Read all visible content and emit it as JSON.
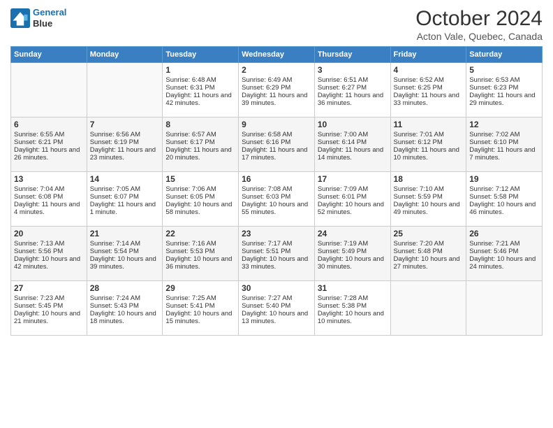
{
  "header": {
    "logo_line1": "General",
    "logo_line2": "Blue",
    "month": "October 2024",
    "location": "Acton Vale, Quebec, Canada"
  },
  "weekdays": [
    "Sunday",
    "Monday",
    "Tuesday",
    "Wednesday",
    "Thursday",
    "Friday",
    "Saturday"
  ],
  "weeks": [
    [
      {
        "day": "",
        "sunrise": "",
        "sunset": "",
        "daylight": ""
      },
      {
        "day": "",
        "sunrise": "",
        "sunset": "",
        "daylight": ""
      },
      {
        "day": "1",
        "sunrise": "Sunrise: 6:48 AM",
        "sunset": "Sunset: 6:31 PM",
        "daylight": "Daylight: 11 hours and 42 minutes."
      },
      {
        "day": "2",
        "sunrise": "Sunrise: 6:49 AM",
        "sunset": "Sunset: 6:29 PM",
        "daylight": "Daylight: 11 hours and 39 minutes."
      },
      {
        "day": "3",
        "sunrise": "Sunrise: 6:51 AM",
        "sunset": "Sunset: 6:27 PM",
        "daylight": "Daylight: 11 hours and 36 minutes."
      },
      {
        "day": "4",
        "sunrise": "Sunrise: 6:52 AM",
        "sunset": "Sunset: 6:25 PM",
        "daylight": "Daylight: 11 hours and 33 minutes."
      },
      {
        "day": "5",
        "sunrise": "Sunrise: 6:53 AM",
        "sunset": "Sunset: 6:23 PM",
        "daylight": "Daylight: 11 hours and 29 minutes."
      }
    ],
    [
      {
        "day": "6",
        "sunrise": "Sunrise: 6:55 AM",
        "sunset": "Sunset: 6:21 PM",
        "daylight": "Daylight: 11 hours and 26 minutes."
      },
      {
        "day": "7",
        "sunrise": "Sunrise: 6:56 AM",
        "sunset": "Sunset: 6:19 PM",
        "daylight": "Daylight: 11 hours and 23 minutes."
      },
      {
        "day": "8",
        "sunrise": "Sunrise: 6:57 AM",
        "sunset": "Sunset: 6:17 PM",
        "daylight": "Daylight: 11 hours and 20 minutes."
      },
      {
        "day": "9",
        "sunrise": "Sunrise: 6:58 AM",
        "sunset": "Sunset: 6:16 PM",
        "daylight": "Daylight: 11 hours and 17 minutes."
      },
      {
        "day": "10",
        "sunrise": "Sunrise: 7:00 AM",
        "sunset": "Sunset: 6:14 PM",
        "daylight": "Daylight: 11 hours and 14 minutes."
      },
      {
        "day": "11",
        "sunrise": "Sunrise: 7:01 AM",
        "sunset": "Sunset: 6:12 PM",
        "daylight": "Daylight: 11 hours and 10 minutes."
      },
      {
        "day": "12",
        "sunrise": "Sunrise: 7:02 AM",
        "sunset": "Sunset: 6:10 PM",
        "daylight": "Daylight: 11 hours and 7 minutes."
      }
    ],
    [
      {
        "day": "13",
        "sunrise": "Sunrise: 7:04 AM",
        "sunset": "Sunset: 6:08 PM",
        "daylight": "Daylight: 11 hours and 4 minutes."
      },
      {
        "day": "14",
        "sunrise": "Sunrise: 7:05 AM",
        "sunset": "Sunset: 6:07 PM",
        "daylight": "Daylight: 11 hours and 1 minute."
      },
      {
        "day": "15",
        "sunrise": "Sunrise: 7:06 AM",
        "sunset": "Sunset: 6:05 PM",
        "daylight": "Daylight: 10 hours and 58 minutes."
      },
      {
        "day": "16",
        "sunrise": "Sunrise: 7:08 AM",
        "sunset": "Sunset: 6:03 PM",
        "daylight": "Daylight: 10 hours and 55 minutes."
      },
      {
        "day": "17",
        "sunrise": "Sunrise: 7:09 AM",
        "sunset": "Sunset: 6:01 PM",
        "daylight": "Daylight: 10 hours and 52 minutes."
      },
      {
        "day": "18",
        "sunrise": "Sunrise: 7:10 AM",
        "sunset": "Sunset: 5:59 PM",
        "daylight": "Daylight: 10 hours and 49 minutes."
      },
      {
        "day": "19",
        "sunrise": "Sunrise: 7:12 AM",
        "sunset": "Sunset: 5:58 PM",
        "daylight": "Daylight: 10 hours and 46 minutes."
      }
    ],
    [
      {
        "day": "20",
        "sunrise": "Sunrise: 7:13 AM",
        "sunset": "Sunset: 5:56 PM",
        "daylight": "Daylight: 10 hours and 42 minutes."
      },
      {
        "day": "21",
        "sunrise": "Sunrise: 7:14 AM",
        "sunset": "Sunset: 5:54 PM",
        "daylight": "Daylight: 10 hours and 39 minutes."
      },
      {
        "day": "22",
        "sunrise": "Sunrise: 7:16 AM",
        "sunset": "Sunset: 5:53 PM",
        "daylight": "Daylight: 10 hours and 36 minutes."
      },
      {
        "day": "23",
        "sunrise": "Sunrise: 7:17 AM",
        "sunset": "Sunset: 5:51 PM",
        "daylight": "Daylight: 10 hours and 33 minutes."
      },
      {
        "day": "24",
        "sunrise": "Sunrise: 7:19 AM",
        "sunset": "Sunset: 5:49 PM",
        "daylight": "Daylight: 10 hours and 30 minutes."
      },
      {
        "day": "25",
        "sunrise": "Sunrise: 7:20 AM",
        "sunset": "Sunset: 5:48 PM",
        "daylight": "Daylight: 10 hours and 27 minutes."
      },
      {
        "day": "26",
        "sunrise": "Sunrise: 7:21 AM",
        "sunset": "Sunset: 5:46 PM",
        "daylight": "Daylight: 10 hours and 24 minutes."
      }
    ],
    [
      {
        "day": "27",
        "sunrise": "Sunrise: 7:23 AM",
        "sunset": "Sunset: 5:45 PM",
        "daylight": "Daylight: 10 hours and 21 minutes."
      },
      {
        "day": "28",
        "sunrise": "Sunrise: 7:24 AM",
        "sunset": "Sunset: 5:43 PM",
        "daylight": "Daylight: 10 hours and 18 minutes."
      },
      {
        "day": "29",
        "sunrise": "Sunrise: 7:25 AM",
        "sunset": "Sunset: 5:41 PM",
        "daylight": "Daylight: 10 hours and 15 minutes."
      },
      {
        "day": "30",
        "sunrise": "Sunrise: 7:27 AM",
        "sunset": "Sunset: 5:40 PM",
        "daylight": "Daylight: 10 hours and 13 minutes."
      },
      {
        "day": "31",
        "sunrise": "Sunrise: 7:28 AM",
        "sunset": "Sunset: 5:38 PM",
        "daylight": "Daylight: 10 hours and 10 minutes."
      },
      {
        "day": "",
        "sunrise": "",
        "sunset": "",
        "daylight": ""
      },
      {
        "day": "",
        "sunrise": "",
        "sunset": "",
        "daylight": ""
      }
    ]
  ]
}
